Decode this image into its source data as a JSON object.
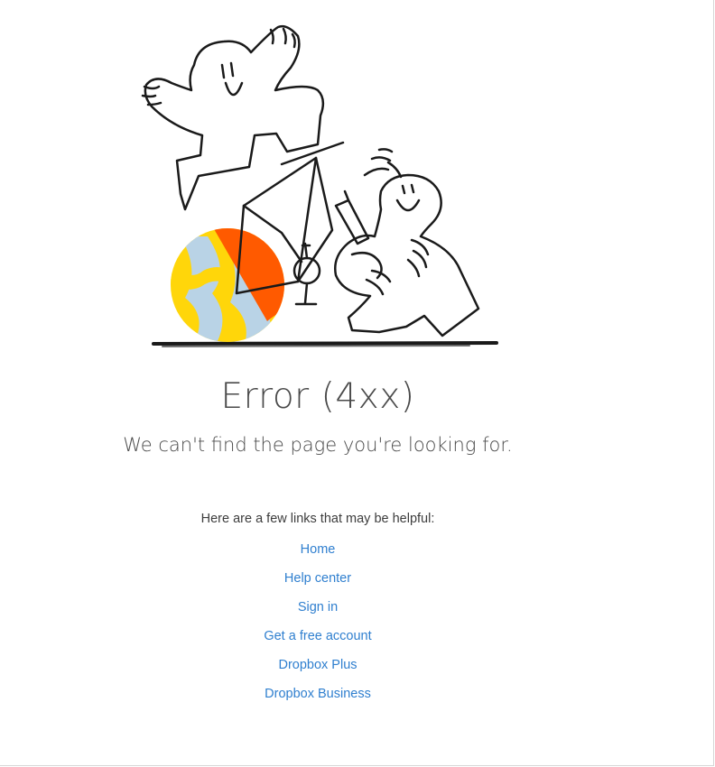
{
  "error": {
    "title": "Error (4xx)",
    "subtitle": "We can't find the page you're looking for."
  },
  "links": {
    "intro": "Here are a few links that may be helpful:",
    "items": [
      {
        "label": "Home"
      },
      {
        "label": "Help center"
      },
      {
        "label": "Sign in"
      },
      {
        "label": "Get a free account"
      },
      {
        "label": "Dropbox Plus"
      },
      {
        "label": "Dropbox Business"
      }
    ]
  },
  "colors": {
    "link": "#2f7fcf",
    "text": "#4a4a4a",
    "ball_orange": "#ff5a00",
    "ball_yellow": "#ffd60a",
    "ball_blue": "#b9d3e6"
  },
  "illustration": {
    "icon": "error-illustration"
  }
}
